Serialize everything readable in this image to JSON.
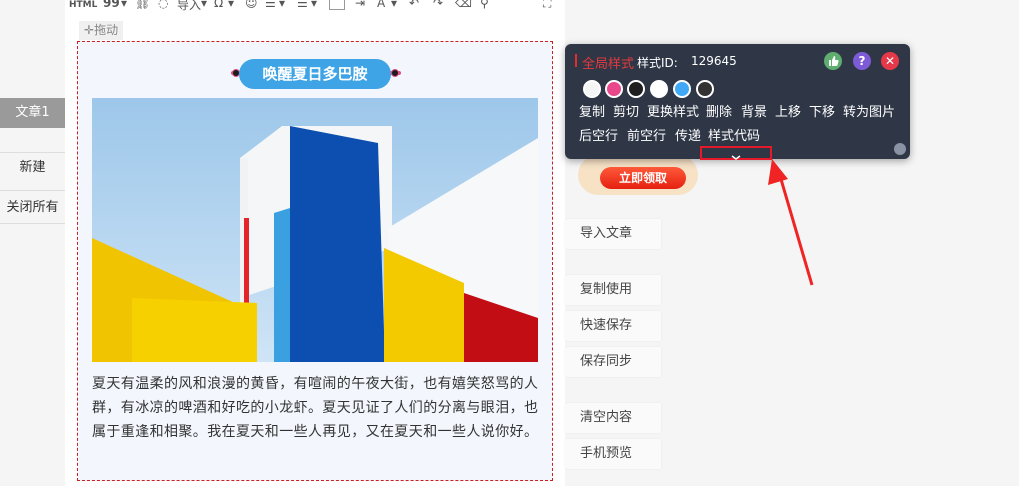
{
  "toolbar": {
    "html_label": "HTML",
    "quote_label": "99",
    "import_label": "导入"
  },
  "editor": {
    "drag_label": "拖动"
  },
  "article": {
    "title": "唤醒夏日多巴胺",
    "body": "夏天有温柔的风和浪漫的黄昏，有喧闹的午夜大街，也有嬉笑怒骂的人群，有冰凉的啤酒和好吃的小龙虾。夏天见证了人们的分离与眼泪，也属于重逢和相聚。我在夏天和一些人再见，又在夏天和一些人说你好。",
    "pill_color": "#3ea4e6"
  },
  "sidebar": {
    "items": [
      {
        "label": "文章1"
      },
      {
        "label": "新建"
      },
      {
        "label": "关闭所有"
      }
    ]
  },
  "style_panel": {
    "title": "全局样式",
    "id_label": "样式ID:",
    "id_value": "129645",
    "swatches": [
      "#f5f5f5",
      "#e8478b",
      "#1f1f1f",
      "#ffffff",
      "#3fa9f5",
      "#333333"
    ],
    "actions_row1": [
      "复制",
      "剪切",
      "更换样式",
      "删除",
      "背景",
      "上移",
      "下移",
      "转为图片"
    ],
    "actions_row2": [
      "后空行",
      "前空行",
      "传递",
      "样式代码"
    ],
    "icons": [
      "thumbs-up-icon",
      "help-icon",
      "close-icon"
    ]
  },
  "right_actions": [
    {
      "label": "导入文章"
    },
    {
      "label": "复制使用"
    },
    {
      "label": "快速保存"
    },
    {
      "label": "保存同步"
    },
    {
      "label": "清空内容"
    },
    {
      "label": "手机预览"
    }
  ],
  "promo": {
    "button_label": "立即领取"
  }
}
